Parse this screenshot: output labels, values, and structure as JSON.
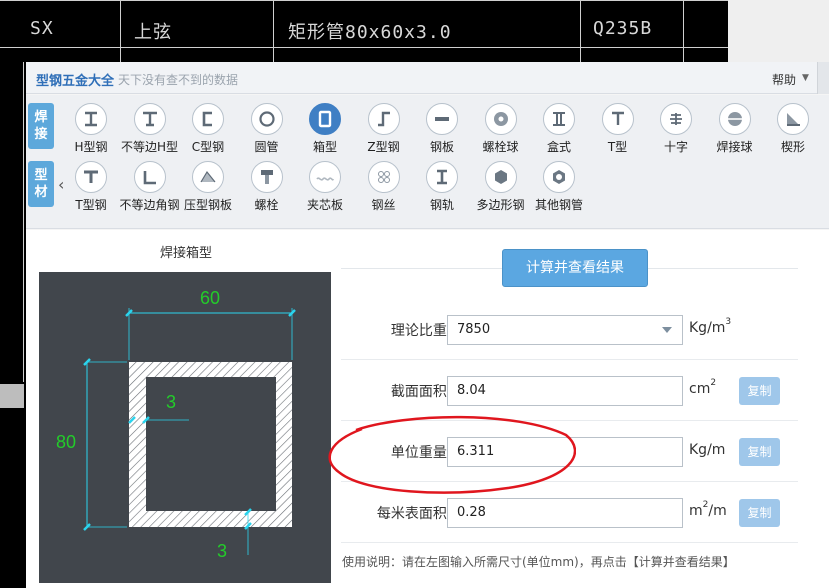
{
  "cad": {
    "cells": [
      "SX",
      "上弦",
      "矩形管80x60x3.0",
      "Q235B"
    ]
  },
  "app": {
    "title": "型钢五金大全",
    "subtitle": "天下没有查不到的数据",
    "help_label": "帮助"
  },
  "categories": {
    "weld": [
      "焊",
      "接"
    ],
    "section": [
      "型",
      "材"
    ]
  },
  "shapes_row1": [
    {
      "label": "H型钢",
      "icon": "h-beam-icon"
    },
    {
      "label": "不等边H型",
      "icon": "unequal-h-icon"
    },
    {
      "label": "C型钢",
      "icon": "c-channel-icon"
    },
    {
      "label": "圆管",
      "icon": "round-pipe-icon"
    },
    {
      "label": "箱型",
      "icon": "box-section-icon",
      "active": true
    },
    {
      "label": "Z型钢",
      "icon": "z-section-icon"
    },
    {
      "label": "钢板",
      "icon": "steel-plate-icon"
    },
    {
      "label": "螺栓球",
      "icon": "bolt-ball-icon"
    },
    {
      "label": "盒式",
      "icon": "box-type-icon"
    },
    {
      "label": "T型",
      "icon": "t-shape-icon"
    },
    {
      "label": "十字",
      "icon": "cross-icon"
    },
    {
      "label": "焊接球",
      "icon": "weld-ball-icon"
    },
    {
      "label": "楔形",
      "icon": "wedge-icon"
    }
  ],
  "shapes_row2": [
    {
      "label": "T型钢",
      "icon": "t-steel-icon"
    },
    {
      "label": "不等边角钢",
      "icon": "angle-steel-icon"
    },
    {
      "label": "压型钢板",
      "icon": "profiled-plate-icon"
    },
    {
      "label": "螺栓",
      "icon": "bolt-icon"
    },
    {
      "label": "夹芯板",
      "icon": "sandwich-panel-icon"
    },
    {
      "label": "钢丝",
      "icon": "steel-wire-icon"
    },
    {
      "label": "钢轨",
      "icon": "rail-icon"
    },
    {
      "label": "多边形钢",
      "icon": "polygon-steel-icon"
    },
    {
      "label": "其他钢管",
      "icon": "other-pipe-icon"
    }
  ],
  "panel": {
    "title": "焊接箱型",
    "calc_button": "计算并查看结果",
    "usage": "使用说明：请在左图输入所需尺寸(单位mm)，再点击【计算并查看结果】"
  },
  "drawing": {
    "width_dim": "60",
    "height_dim": "80",
    "web_thickness": "3",
    "flange_thickness": "3"
  },
  "rows": [
    {
      "label": "理论比重 :",
      "value": "7850",
      "unit_main": "Kg/m",
      "unit_sup": "3",
      "copy": ""
    },
    {
      "label": "截面面积 :",
      "value": "8.04",
      "unit_main": "cm",
      "unit_sup": "2",
      "copy": "复制"
    },
    {
      "label": "单位重量 :",
      "value": "6.311",
      "unit_main": "Kg/m",
      "unit_sup": "",
      "copy": "复制"
    },
    {
      "label": "每米表面积 :",
      "value": "0.28",
      "unit_main": "m",
      "unit_sup": "2",
      "unit_tail": "/m",
      "copy": "复制"
    }
  ],
  "colors": {
    "accent": "#5da8db",
    "annotation": "#e0161e",
    "dimension": "#2ad4ee",
    "dim_text": "#23cc2a"
  }
}
